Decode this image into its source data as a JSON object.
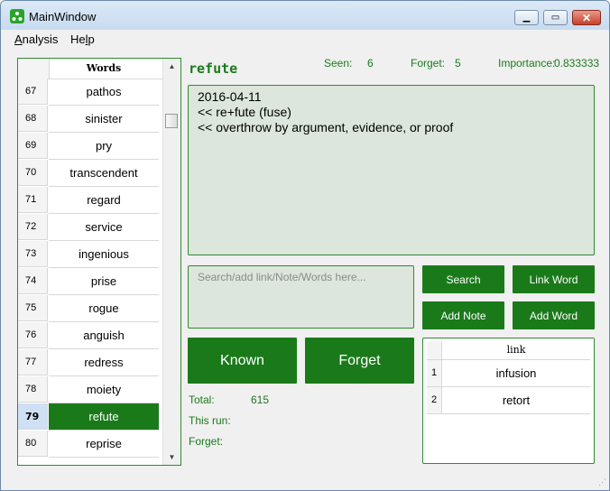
{
  "window": {
    "title": "MainWindow"
  },
  "menu": {
    "analysis_rest": "nalysis",
    "analysis_mnemonic": "A",
    "help_prefix": "He",
    "help_mnemonic": "l",
    "help_rest": "p"
  },
  "wordlist": {
    "header": "Words",
    "rows": [
      {
        "num": "67",
        "word": "pathos"
      },
      {
        "num": "68",
        "word": "sinister"
      },
      {
        "num": "69",
        "word": "pry"
      },
      {
        "num": "70",
        "word": "transcendent"
      },
      {
        "num": "71",
        "word": "regard"
      },
      {
        "num": "72",
        "word": "service"
      },
      {
        "num": "73",
        "word": "ingenious"
      },
      {
        "num": "74",
        "word": "prise"
      },
      {
        "num": "75",
        "word": "rogue"
      },
      {
        "num": "76",
        "word": "anguish"
      },
      {
        "num": "77",
        "word": "redress"
      },
      {
        "num": "78",
        "word": "moiety"
      },
      {
        "num": "79",
        "word": "refute"
      },
      {
        "num": "80",
        "word": "reprise"
      }
    ],
    "selected": "79"
  },
  "current": {
    "word": "refute",
    "seen_label": "Seen:",
    "seen": "6",
    "forget_label": "Forget:",
    "forget": "5",
    "importance_label": "Importance:",
    "importance": "0.833333"
  },
  "notes": {
    "lines": [
      "2016-04-11",
      "<< re+fute (fuse)",
      "<< overthrow by argument, evidence, or proof"
    ]
  },
  "search": {
    "placeholder": "Search/add link/Note/Words here...",
    "value": ""
  },
  "buttons": {
    "search": "Search",
    "link_word": "Link Word",
    "add_note": "Add Note",
    "add_word": "Add Word",
    "known": "Known",
    "forget": "Forget"
  },
  "summary": {
    "total_label": "Total:",
    "total": "615",
    "this_run_label": "This run:",
    "this_run": "",
    "forget_label": "Forget:",
    "forget": ""
  },
  "links": {
    "header": "link",
    "rows": [
      {
        "num": "1",
        "word": "infusion"
      },
      {
        "num": "2",
        "word": "retort"
      }
    ]
  },
  "colors": {
    "accent": "#1a7a1a",
    "panel_bg": "#dce6dc",
    "selected_row": "#1a7a1a"
  }
}
